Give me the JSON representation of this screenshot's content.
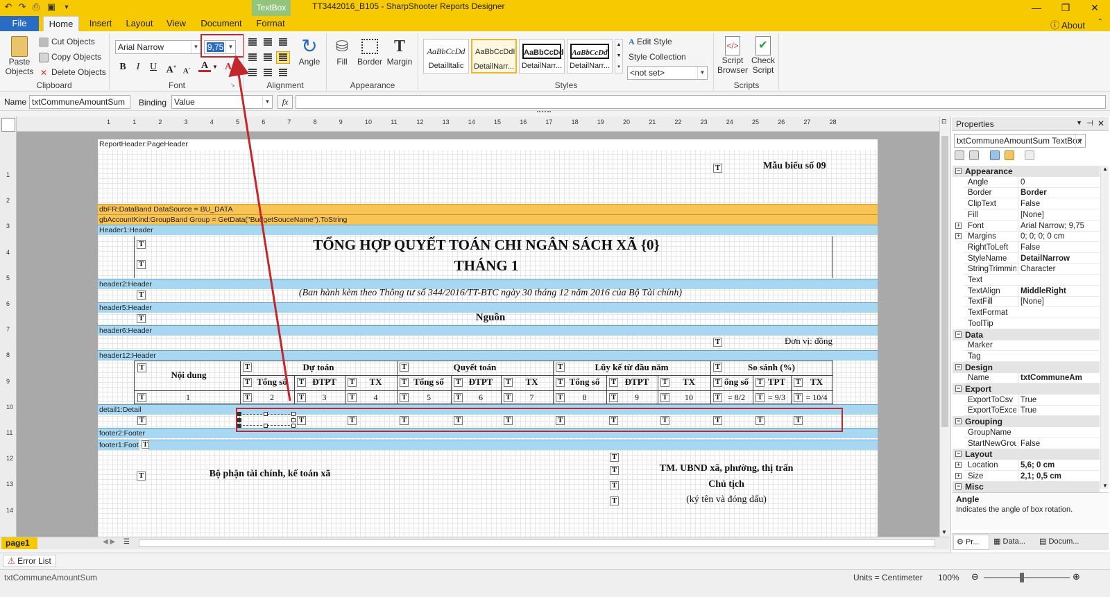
{
  "window": {
    "title": "TT3442016_B105 - SharpShooter Reports Designer",
    "context_tab": "TextBox"
  },
  "tabs": [
    "File",
    "Home",
    "Insert",
    "Layout",
    "View",
    "Document",
    "Format"
  ],
  "about": "About",
  "ribbon": {
    "clipboard": {
      "label": "Clipboard",
      "paste": "Paste\nObjects",
      "cut": "Cut Objects",
      "copy": "Copy Objects",
      "delete": "Delete Objects"
    },
    "font": {
      "label": "Font",
      "family": "Arial Narrow",
      "size": "9,75",
      "bold": "B",
      "italic": "I",
      "underline": "U"
    },
    "alignment": {
      "label": "Alignment",
      "angle": "Angle"
    },
    "appearance": {
      "label": "Appearance",
      "fill": "Fill",
      "border": "Border",
      "margin": "Margin"
    },
    "styles": {
      "label": "Styles",
      "tiles": [
        {
          "sample": "AaBbCcDd",
          "name": "DetailItalic"
        },
        {
          "sample": "AaBbCcDdI",
          "name": "DetailNarr..."
        },
        {
          "sample": "AaBbCcDd",
          "name": "DetailNarr..."
        },
        {
          "sample": "AaBbCcDd",
          "name": "DetailNarr..."
        }
      ],
      "edit_style": "Edit Style",
      "style_collection": "Style Collection",
      "not_set": "<not set>"
    },
    "scripts": {
      "label": "Scripts",
      "browser": "Script\nBrowser",
      "check": "Check\nScript"
    }
  },
  "namebar": {
    "name_label": "Name",
    "name_value": "txtCommuneAmountSum",
    "binding_label": "Binding",
    "binding_value": "Value",
    "fx": "fx"
  },
  "ruler": [
    "1",
    "1",
    "2",
    "3",
    "4",
    "5",
    "6",
    "7",
    "8",
    "9",
    "10",
    "11",
    "12",
    "13",
    "14",
    "15",
    "16",
    "17",
    "18",
    "19",
    "20",
    "21",
    "22",
    "23",
    "24",
    "25",
    "26",
    "27",
    "28"
  ],
  "left_ruler": [
    "1",
    "2",
    "3",
    "4",
    "5",
    "6",
    "7",
    "8",
    "9",
    "10",
    "11",
    "12",
    "13",
    "14"
  ],
  "bands": {
    "report_header": "ReportHeader:PageHeader",
    "data_band": "dbFR:DataBand  DataSource = BU_DATA",
    "group_band": "gbAccountKind:GroupBand  Group = GetData(\"BudgetSouceName\").ToString",
    "header1": "Header1:Header",
    "header2": "header2:Header",
    "header5": "header5:Header",
    "header6": "header6:Header",
    "header12": "header12:Header",
    "detail1": "detail1:Detail",
    "footer2": "footer2:Footer",
    "footer1": "footer1:Foot"
  },
  "report": {
    "form_no": "Mẫu biểu số 09",
    "title1": "TỔNG HỢP QUYẾT TOÁN CHI NGÂN SÁCH XÃ {0}",
    "title2": "THÁNG 1",
    "subtitle": "(Ban hành kèm theo Thông tư số 344/2016/TT-BTC ngày 30 tháng 12 năm 2016 của Bộ Tài chính)",
    "source": "Nguồn",
    "unit": "Đơn vị: đồng",
    "col_content": "Nội dung",
    "groups": [
      "Dự toán",
      "Quyết toán",
      "Lũy kế từ đầu năm",
      "So sánh (%)"
    ],
    "sub": [
      "Tổng số",
      "ĐTPT",
      "TX",
      "Tổng số",
      "ĐTPT",
      "TX",
      "Tổng số",
      "ĐTPT",
      "TX",
      "ổng số",
      "TPT",
      "TX"
    ],
    "nums": [
      "1",
      "2",
      "3",
      "4",
      "5",
      "6",
      "7",
      "8",
      "9",
      "10",
      "= 8/2",
      "= 9/3",
      "= 10/4"
    ],
    "finance_dept": "Bộ phận tài chính, kế toán xã",
    "ubnd": "TM. UBND xã, phường, thị trấn",
    "chairman": "Chủ tịch",
    "sign": "(ký tên và đóng dấu)",
    "t": "T"
  },
  "page_tab": "page1",
  "properties": {
    "title": "Properties",
    "selector": "txtCommuneAmountSum TextBox",
    "rows": [
      {
        "type": "cat",
        "name": "Appearance"
      },
      {
        "name": "Angle",
        "value": "0"
      },
      {
        "name": "Border",
        "value": "Border",
        "bold": true
      },
      {
        "name": "ClipText",
        "value": "False"
      },
      {
        "name": "Fill",
        "value": "[None]"
      },
      {
        "name": "Font",
        "value": "Arial Narrow; 9,75",
        "exp": true
      },
      {
        "name": "Margins",
        "value": "0; 0; 0; 0 cm",
        "exp": true
      },
      {
        "name": "RightToLeft",
        "value": "False"
      },
      {
        "name": "StyleName",
        "value": "DetailNarrow",
        "bold": true
      },
      {
        "name": "StringTrimming",
        "value": "Character"
      },
      {
        "name": "Text",
        "value": ""
      },
      {
        "name": "TextAlign",
        "value": "MiddleRight",
        "bold": true
      },
      {
        "name": "TextFill",
        "value": "[None]"
      },
      {
        "name": "TextFormat",
        "value": ""
      },
      {
        "name": "ToolTip",
        "value": ""
      },
      {
        "type": "cat",
        "name": "Data"
      },
      {
        "name": "Marker",
        "value": ""
      },
      {
        "name": "Tag",
        "value": ""
      },
      {
        "type": "cat",
        "name": "Design"
      },
      {
        "name": "Name",
        "value": "txtCommuneAm",
        "bold": true
      },
      {
        "type": "cat",
        "name": "Export"
      },
      {
        "name": "ExportToCsv",
        "value": "True"
      },
      {
        "name": "ExportToExcel",
        "value": "True"
      },
      {
        "type": "cat",
        "name": "Grouping"
      },
      {
        "name": "GroupName",
        "value": ""
      },
      {
        "name": "StartNewGroup",
        "value": "False"
      },
      {
        "type": "cat",
        "name": "Layout"
      },
      {
        "name": "Location",
        "value": "5,6; 0 cm",
        "bold": true,
        "exp": true
      },
      {
        "name": "Size",
        "value": "2,1; 0,5 cm",
        "bold": true,
        "exp": true
      },
      {
        "type": "cat",
        "name": "Misc"
      }
    ],
    "help_title": "Angle",
    "help_text": "Indicates the angle of box rotation.",
    "bottom_tabs": [
      "Pr...",
      "Data...",
      "Docum..."
    ]
  },
  "error_list": "Error List",
  "status": {
    "left": "txtCommuneAmountSum",
    "units": "Units = Centimeter",
    "zoom": "100%"
  },
  "colors": {
    "title_bar": "#f7c900",
    "accent_red": "#c0282c",
    "band_blue": "#a8d7f2",
    "band_orange": "#f9c456"
  }
}
